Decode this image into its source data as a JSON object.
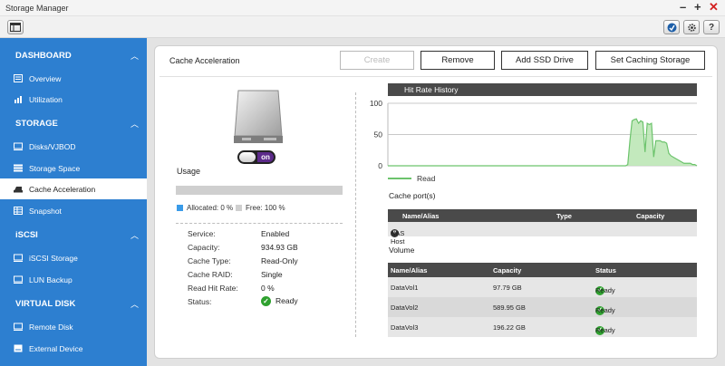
{
  "window": {
    "title": "Storage Manager",
    "controls": [
      "–",
      "+",
      "✕"
    ]
  },
  "toolbar": {
    "left_icon": "app-menu-icon",
    "right_icons": [
      "update-icon",
      "settings-gear-icon",
      "help-icon"
    ],
    "help_label": "?"
  },
  "sidebar": {
    "sections": [
      {
        "label": "DASHBOARD",
        "items": [
          {
            "label": "Overview",
            "icon": "overview-icon"
          },
          {
            "label": "Utilization",
            "icon": "utilization-chart-icon"
          }
        ]
      },
      {
        "label": "STORAGE",
        "items": [
          {
            "label": "Disks/VJBOD",
            "icon": "disks-icon"
          },
          {
            "label": "Storage Space",
            "icon": "storage-space-icon"
          },
          {
            "label": "Cache Acceleration",
            "icon": "cache-drive-icon",
            "active": true
          },
          {
            "label": "Snapshot",
            "icon": "snapshot-icon"
          }
        ]
      },
      {
        "label": "iSCSI",
        "items": [
          {
            "label": "iSCSI Storage",
            "icon": "iscsi-storage-icon"
          },
          {
            "label": "LUN Backup",
            "icon": "lun-backup-icon"
          }
        ]
      },
      {
        "label": "VIRTUAL DISK",
        "items": [
          {
            "label": "Remote Disk",
            "icon": "remote-disk-icon"
          },
          {
            "label": "External Device",
            "icon": "external-device-icon"
          }
        ]
      }
    ]
  },
  "main": {
    "title": "Cache Acceleration",
    "buttons": {
      "create": "Create",
      "remove": "Remove",
      "add_ssd": "Add SSD Drive",
      "set_caching": "Set Caching Storage"
    },
    "toggle_state": "on",
    "usage": {
      "label": "Usage",
      "allocated_percent": 0,
      "allocated_label": "Allocated: 0 %",
      "free_label": "Free: 100 %",
      "allocated_color": "#3a9be8",
      "free_color": "#cfcfcf"
    },
    "details": [
      {
        "key": "Service:",
        "value": "Enabled"
      },
      {
        "key": "Capacity:",
        "value": "934.93 GB"
      },
      {
        "key": "Cache Type:",
        "value": "Read-Only"
      },
      {
        "key": "Cache RAID:",
        "value": "Single"
      },
      {
        "key": "Read Hit Rate:",
        "value": "0 %"
      },
      {
        "key": "Status:",
        "value": "Ready",
        "status_ok": true
      }
    ],
    "hit_rate": {
      "title": "Hit Rate History",
      "legend": "Read",
      "color": "#6cc36c"
    },
    "cache_ports": {
      "label": "Cache port(s)",
      "columns": [
        "Name/Alias",
        "Type",
        "Capacity"
      ],
      "rows": [
        {
          "name": "NAS Host",
          "type": "",
          "capacity": ""
        }
      ]
    },
    "volume": {
      "label": "Volume",
      "columns": [
        "Name/Alias",
        "Capacity",
        "Status"
      ],
      "rows": [
        {
          "name": "DataVol1",
          "capacity": "97.79 GB",
          "status": "Ready"
        },
        {
          "name": "DataVol2",
          "capacity": "589.95 GB",
          "status": "Ready"
        },
        {
          "name": "DataVol3",
          "capacity": "196.22 GB",
          "status": "Ready"
        }
      ]
    }
  },
  "chart_data": {
    "type": "area",
    "series": [
      {
        "name": "Read",
        "values": [
          0,
          0,
          0,
          0,
          0,
          0,
          0,
          0,
          0,
          0,
          0,
          0,
          0,
          0,
          0,
          0,
          0,
          0,
          0,
          0,
          0,
          0,
          0,
          0,
          0,
          0,
          0,
          0,
          0,
          0,
          0,
          0,
          0,
          0,
          0,
          0,
          0,
          0,
          0,
          0,
          0,
          0,
          0,
          0,
          0,
          0,
          0,
          0,
          0,
          0,
          0,
          0,
          0,
          0,
          0,
          0,
          0,
          0,
          0,
          0,
          0,
          0,
          0,
          0,
          0,
          0,
          0,
          0,
          0,
          0,
          0,
          0,
          0,
          0,
          0,
          0,
          0,
          0,
          0,
          0,
          0,
          0,
          0,
          0,
          0,
          0,
          0,
          0,
          0,
          0,
          0,
          0,
          0,
          0,
          0,
          0,
          0,
          0,
          0,
          0,
          0,
          0,
          0,
          0,
          0,
          0,
          0,
          0,
          0,
          0,
          0,
          2,
          40,
          72,
          74,
          75,
          68,
          72,
          70,
          22,
          68,
          66,
          68,
          14,
          40,
          40,
          40,
          38,
          38,
          36,
          20,
          16,
          14,
          12,
          10,
          8,
          6,
          4,
          4,
          4,
          4,
          2,
          2,
          0
        ]
      }
    ],
    "ylim": [
      0,
      100
    ],
    "yticks": [
      0,
      50,
      100
    ],
    "grid": true
  }
}
